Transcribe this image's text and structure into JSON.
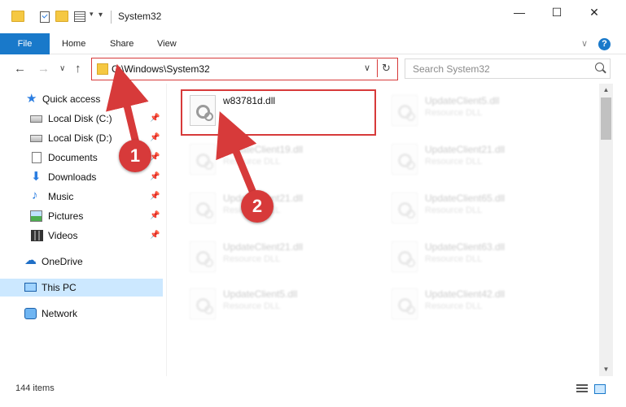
{
  "window": {
    "title": "System32",
    "minimize_glyph": "—",
    "maximize_glyph": "☐",
    "close_glyph": "✕"
  },
  "ribbon": {
    "tabs": [
      "File",
      "Home",
      "Share",
      "View"
    ],
    "expand_glyph": "∨",
    "help_glyph": "?"
  },
  "nav": {
    "back_glyph": "←",
    "forward_glyph": "→",
    "recent_glyph": "∨",
    "up_glyph": "↑"
  },
  "address": {
    "path": "C:\\Windows\\System32",
    "dropdown_glyph": "∨",
    "refresh_glyph": "↻"
  },
  "search": {
    "placeholder": "Search System32"
  },
  "sidebar": {
    "items": [
      {
        "label": "Quick access",
        "icon": "star-icon",
        "pinned": false
      },
      {
        "label": "Local Disk (C:)",
        "icon": "drive-icon",
        "pinned": true
      },
      {
        "label": "Local Disk (D:)",
        "icon": "drive-icon",
        "pinned": true
      },
      {
        "label": "Documents",
        "icon": "documents-icon",
        "pinned": true
      },
      {
        "label": "Downloads",
        "icon": "downloads-icon",
        "pinned": true
      },
      {
        "label": "Music",
        "icon": "music-icon",
        "pinned": true
      },
      {
        "label": "Pictures",
        "icon": "pictures-icon",
        "pinned": true
      },
      {
        "label": "Videos",
        "icon": "videos-icon",
        "pinned": true
      },
      {
        "label": "OneDrive",
        "icon": "onedrive-icon",
        "pinned": false
      },
      {
        "label": "This PC",
        "icon": "pc-icon",
        "pinned": false,
        "selected": true
      },
      {
        "label": "Network",
        "icon": "network-icon",
        "pinned": false
      }
    ],
    "pin_glyph": "📌"
  },
  "files": [
    {
      "name": "w83781d.dll",
      "type": "",
      "highlighted": true
    },
    {
      "name": "UpdateClient5.dll",
      "type": "Resource DLL"
    },
    {
      "name": "UpdateClient19.dll",
      "type": "Resource DLL"
    },
    {
      "name": "UpdateClient21.dll",
      "type": "Resource DLL"
    },
    {
      "name": "UpdateClient21.dll",
      "type": "Resource DLL"
    },
    {
      "name": "UpdateClient65.dll",
      "type": "Resource DLL"
    },
    {
      "name": "UpdateClient21.dll",
      "type": "Resource DLL"
    },
    {
      "name": "UpdateClient63.dll",
      "type": "Resource DLL"
    },
    {
      "name": "UpdateClient5.dll",
      "type": "Resource DLL"
    },
    {
      "name": "UpdateClient42.dll",
      "type": "Resource DLL"
    }
  ],
  "status": {
    "item_count": "144 items"
  },
  "annotations": {
    "badge_1": "1",
    "badge_2": "2",
    "color": "#d73a3a"
  },
  "colors": {
    "accent": "#1979ca",
    "selection": "#cce8ff"
  }
}
